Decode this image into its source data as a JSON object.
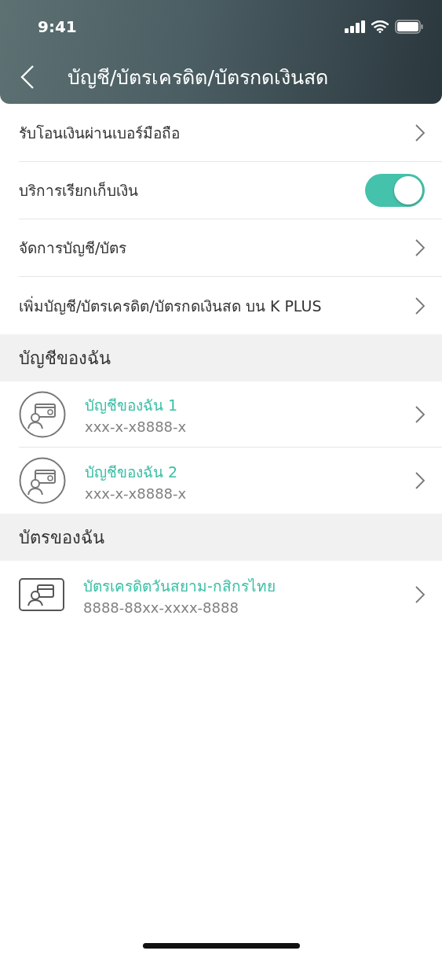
{
  "status_bar": {
    "time": "9:41"
  },
  "header": {
    "title": "บัญชี/บัตรเครดิต/บัตรกดเงินสด"
  },
  "settings": [
    {
      "kind": "link",
      "label": "รับโอนเงินผ่านเบอร์มือถือ"
    },
    {
      "kind": "toggle",
      "label": "บริการเรียกเก็บเงิน",
      "on": true
    },
    {
      "kind": "link",
      "label": "จัดการบัญชี/บัตร"
    },
    {
      "kind": "link",
      "label": "เพิ่มบัญชี/บัตรเครดิต/บัตรกดเงินสด บน K PLUS"
    }
  ],
  "sections": [
    {
      "title": "บัญชีของฉัน",
      "items": [
        {
          "kind": "account",
          "name": "บัญชีของฉัน 1",
          "number": "xxx-x-x8888-x"
        },
        {
          "kind": "account",
          "name": "บัญชีของฉัน 2",
          "number": "xxx-x-x8888-x"
        }
      ]
    },
    {
      "title": "บัตรของฉัน",
      "items": [
        {
          "kind": "card",
          "name": "บัตรเครดิตวันสยาม-กสิกรไทย",
          "number": "8888-88xx-xxxx-8888"
        }
      ]
    }
  ]
}
